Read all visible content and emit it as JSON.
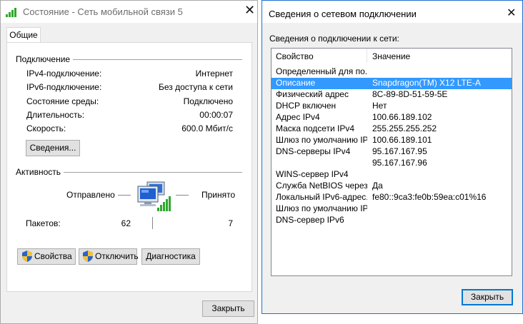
{
  "left_window": {
    "title": "Состояние - Сеть мобильной связи 5",
    "tab": "Общие",
    "connection": {
      "heading": "Подключение",
      "rows": [
        {
          "label": "IPv4-подключение:",
          "value": "Интернет"
        },
        {
          "label": "IPv6-подключение:",
          "value": "Без доступа к сети"
        },
        {
          "label": "Состояние среды:",
          "value": "Подключено"
        },
        {
          "label": "Длительность:",
          "value": "00:00:07"
        },
        {
          "label": "Скорость:",
          "value": "600.0 Мбит/с"
        }
      ],
      "details_button": "Сведения..."
    },
    "activity": {
      "heading": "Активность",
      "sent_label": "Отправлено",
      "received_label": "Принято",
      "packets_label": "Пакетов:",
      "sent_packets": "62",
      "received_packets": "7"
    },
    "buttons": {
      "properties": "Свойства",
      "disable": "Отключить",
      "diagnose": "Диагностика",
      "close": "Закрыть"
    }
  },
  "right_window": {
    "title": "Сведения о сетевом подключении",
    "subtitle": "Сведения о подключении к сети:",
    "columns": [
      "Свойство",
      "Значение"
    ],
    "rows": [
      {
        "prop": "Определенный для по...",
        "value": ""
      },
      {
        "prop": "Описание",
        "value": "Snapdragon(TM) X12 LTE-A",
        "selected": true
      },
      {
        "prop": "Физический адрес",
        "value": "8C-89-8D-51-59-5E"
      },
      {
        "prop": "DHCP включен",
        "value": "Нет"
      },
      {
        "prop": "Адрес IPv4",
        "value": "100.66.189.102"
      },
      {
        "prop": "Маска подсети IPv4",
        "value": "255.255.255.252"
      },
      {
        "prop": "Шлюз по умолчанию IP...",
        "value": "100.66.189.101"
      },
      {
        "prop": "DNS-серверы IPv4",
        "value": "95.167.167.95"
      },
      {
        "prop": "",
        "value": "95.167.167.96"
      },
      {
        "prop": "WINS-сервер IPv4",
        "value": ""
      },
      {
        "prop": "Служба NetBIOS через...",
        "value": "Да"
      },
      {
        "prop": "Локальный IPv6-адрес...",
        "value": "fe80::9ca3:fe0b:59ea:c01%16"
      },
      {
        "prop": "Шлюз по умолчанию IP...",
        "value": ""
      },
      {
        "prop": "DNS-сервер IPv6",
        "value": ""
      }
    ],
    "close_button": "Закрыть"
  },
  "colors": {
    "selection": "#3399ff",
    "focus_border": "#0078d7",
    "signal_green": "#2da82d"
  }
}
